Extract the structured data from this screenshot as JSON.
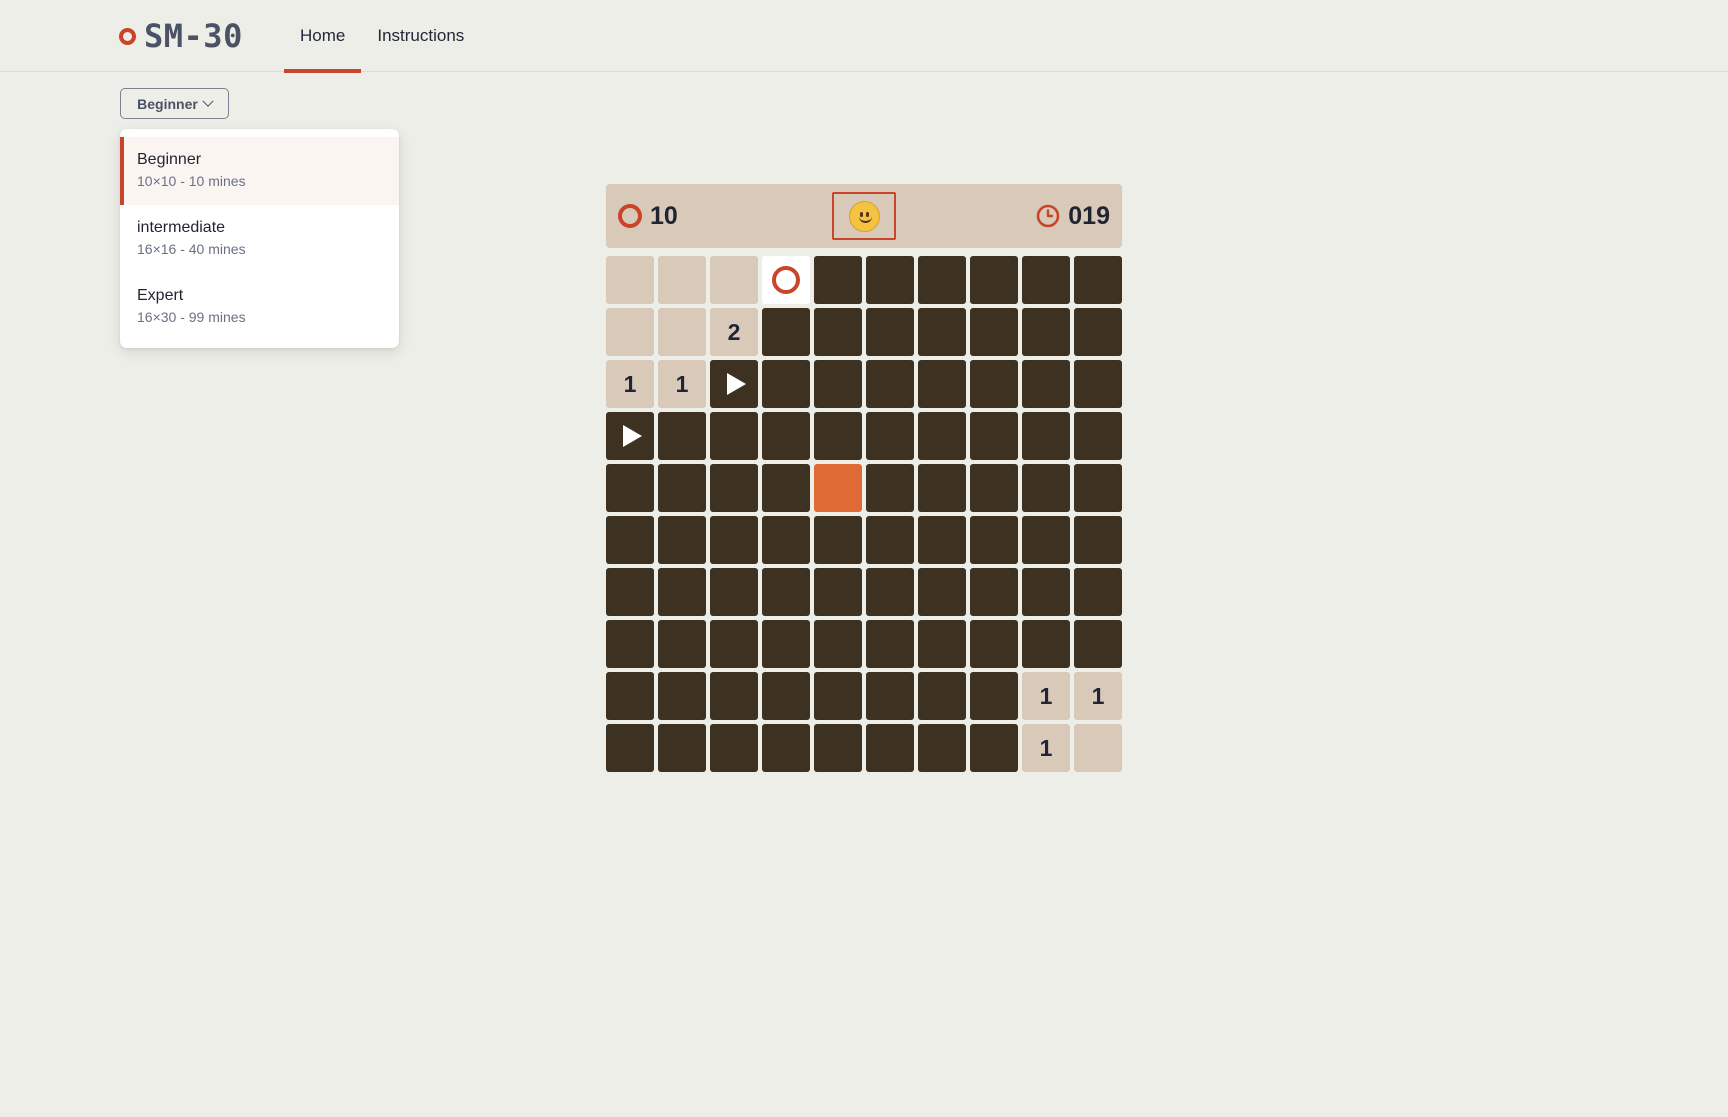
{
  "app": {
    "logo_text": "SM-30"
  },
  "nav": {
    "tabs": [
      {
        "label": "Home",
        "active": true
      },
      {
        "label": "Instructions",
        "active": false
      }
    ]
  },
  "difficulty": {
    "selected_label": "Beginner",
    "options": [
      {
        "title": "Beginner",
        "detail": "10×10 - 10 mines",
        "selected": true
      },
      {
        "title": "intermediate",
        "detail": "16×16 - 40 mines",
        "selected": false
      },
      {
        "title": "Expert",
        "detail": "16×30 - 99 mines",
        "selected": false
      }
    ]
  },
  "game": {
    "mines_remaining": "10",
    "timer": "019",
    "face": "smiley",
    "colors": {
      "accent": "#c8442a",
      "hidden": "#3d3221",
      "revealed": "#d9c9b8",
      "highlight": "#e06a35"
    },
    "board": [
      [
        "E",
        "E",
        "E",
        "O",
        "H",
        "H",
        "H",
        "H",
        "H",
        "H"
      ],
      [
        "E",
        "E",
        "2",
        "H",
        "H",
        "H",
        "H",
        "H",
        "H",
        "H"
      ],
      [
        "1",
        "1",
        "F",
        "H",
        "H",
        "H",
        "H",
        "H",
        "H",
        "H"
      ],
      [
        "F",
        "H",
        "H",
        "H",
        "H",
        "H",
        "H",
        "H",
        "H",
        "H"
      ],
      [
        "H",
        "H",
        "H",
        "H",
        "X",
        "H",
        "H",
        "H",
        "H",
        "H"
      ],
      [
        "H",
        "H",
        "H",
        "H",
        "H",
        "H",
        "H",
        "H",
        "H",
        "H"
      ],
      [
        "H",
        "H",
        "H",
        "H",
        "H",
        "H",
        "H",
        "H",
        "H",
        "H"
      ],
      [
        "H",
        "H",
        "H",
        "H",
        "H",
        "H",
        "H",
        "H",
        "H",
        "H"
      ],
      [
        "H",
        "H",
        "H",
        "H",
        "H",
        "H",
        "H",
        "H",
        "1",
        "1"
      ],
      [
        "H",
        "H",
        "H",
        "H",
        "H",
        "H",
        "H",
        "H",
        "1",
        "E"
      ]
    ]
  }
}
